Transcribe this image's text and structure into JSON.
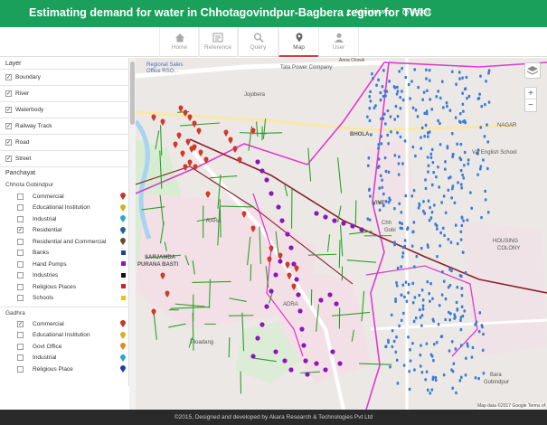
{
  "header": {
    "title": "Estimating demand for water in Chhotagovindpur-Bagbera region for TWIC",
    "admin_label": "Administrator",
    "logout_label": "Logout"
  },
  "nav": {
    "tabs": [
      {
        "label": "Home",
        "icon": "home-icon"
      },
      {
        "label": "Reference",
        "icon": "reference-icon"
      },
      {
        "label": "Query",
        "icon": "search-icon"
      },
      {
        "label": "Map",
        "icon": "map-marker-icon",
        "active": true
      },
      {
        "label": "User",
        "icon": "user-icon"
      }
    ]
  },
  "sidebar": {
    "layer_heading": "Layer",
    "layers": [
      {
        "label": "Boundary",
        "checked": true
      },
      {
        "label": "River",
        "checked": true
      },
      {
        "label": "Waterbody",
        "checked": true
      },
      {
        "label": "Railway Track",
        "checked": true
      },
      {
        "label": "Road",
        "checked": true
      },
      {
        "label": "Street",
        "checked": true
      }
    ],
    "panchayat_heading": "Panchayat",
    "groups": [
      {
        "name": "Chhota Gobindpur",
        "items": [
          {
            "label": "Commercial",
            "checked": false,
            "marker": "pin",
            "color": "#c0392b"
          },
          {
            "label": "Educational Institution",
            "checked": false,
            "marker": "pin",
            "color": "#d4b21c"
          },
          {
            "label": "Industrial",
            "checked": false,
            "marker": "pin",
            "color": "#2aa7c9"
          },
          {
            "label": "Residential",
            "checked": true,
            "marker": "pin",
            "color": "#1f5fa8"
          },
          {
            "label": "Residential and Commercial",
            "checked": false,
            "marker": "pin",
            "color": "#6b4a2a"
          },
          {
            "label": "Banks",
            "checked": false,
            "marker": "square",
            "color": "#1c3fa8"
          },
          {
            "label": "Hand Pumps",
            "checked": false,
            "marker": "square",
            "color": "#8a17b8"
          },
          {
            "label": "Industries",
            "checked": false,
            "marker": "square",
            "color": "#111111"
          },
          {
            "label": "Religious Places",
            "checked": false,
            "marker": "square",
            "color": "#d42020"
          },
          {
            "label": "Schools",
            "checked": false,
            "marker": "square",
            "color": "#e8c417"
          }
        ]
      },
      {
        "name": "Gadhra",
        "items": [
          {
            "label": "Commercial",
            "checked": true,
            "marker": "pin",
            "color": "#c0392b"
          },
          {
            "label": "Educational Institution",
            "checked": false,
            "marker": "pin",
            "color": "#d4b21c"
          },
          {
            "label": "Govt Office",
            "checked": false,
            "marker": "pin",
            "color": "#e08a1a"
          },
          {
            "label": "Industrial",
            "checked": false,
            "marker": "pin",
            "color": "#2aa7c9"
          },
          {
            "label": "Religious Place",
            "checked": false,
            "marker": "pin",
            "color": "#1f3fa8"
          }
        ]
      }
    ]
  },
  "map": {
    "labels": [
      {
        "text": "Regional Sales",
        "name": "map-label-regional-sales"
      },
      {
        "text": "Office RSO...",
        "name": "map-label-office-rso"
      },
      {
        "text": "Tata Power Company",
        "name": "map-label-tata-power"
      },
      {
        "text": "Jojobera",
        "name": "map-label-jojobera"
      },
      {
        "text": "BHOLA",
        "name": "map-label-bhola"
      },
      {
        "text": "VIVE",
        "name": "map-label-vive"
      },
      {
        "text": "Vaj English School",
        "name": "map-label-school"
      },
      {
        "text": "HOUSING",
        "name": "map-label-housing"
      },
      {
        "text": "COLONY",
        "name": "map-label-colony"
      },
      {
        "text": "SARJAMDA",
        "name": "map-label-sarjamda"
      },
      {
        "text": "PURANA BASTI",
        "name": "map-label-purana-basti"
      },
      {
        "text": "Bara",
        "name": "map-label-bara"
      },
      {
        "text": "Gobindpur",
        "name": "map-label-gobindpur"
      },
      {
        "text": "Tiloadang",
        "name": "map-label-tiloadang"
      },
      {
        "text": "ADRA",
        "name": "map-label-adra"
      },
      {
        "text": "Chh",
        "name": "map-label-chh"
      },
      {
        "text": "Gobi",
        "name": "map-label-gobi"
      },
      {
        "text": "Anna Chowk",
        "name": "map-label-anna-chowk"
      },
      {
        "text": "RAHA",
        "name": "map-label-raha"
      },
      {
        "text": "NAGAR",
        "name": "map-label-nagar"
      }
    ],
    "attribution": "Map data ©2017 Google   Terms of",
    "zoom_in": "+",
    "zoom_out": "−"
  },
  "footer": {
    "text": "©2015, Designed and developed by Akara Research & Technologies Pvt Ltd"
  },
  "colors": {
    "header": "#1aa05a",
    "boundary": "#e23ad0",
    "railway": "#8a2030",
    "street": "#2ca02c",
    "residential_marker": "#3a7bd5",
    "handpump": "#8a17b8",
    "commercial": "#d0392b"
  }
}
